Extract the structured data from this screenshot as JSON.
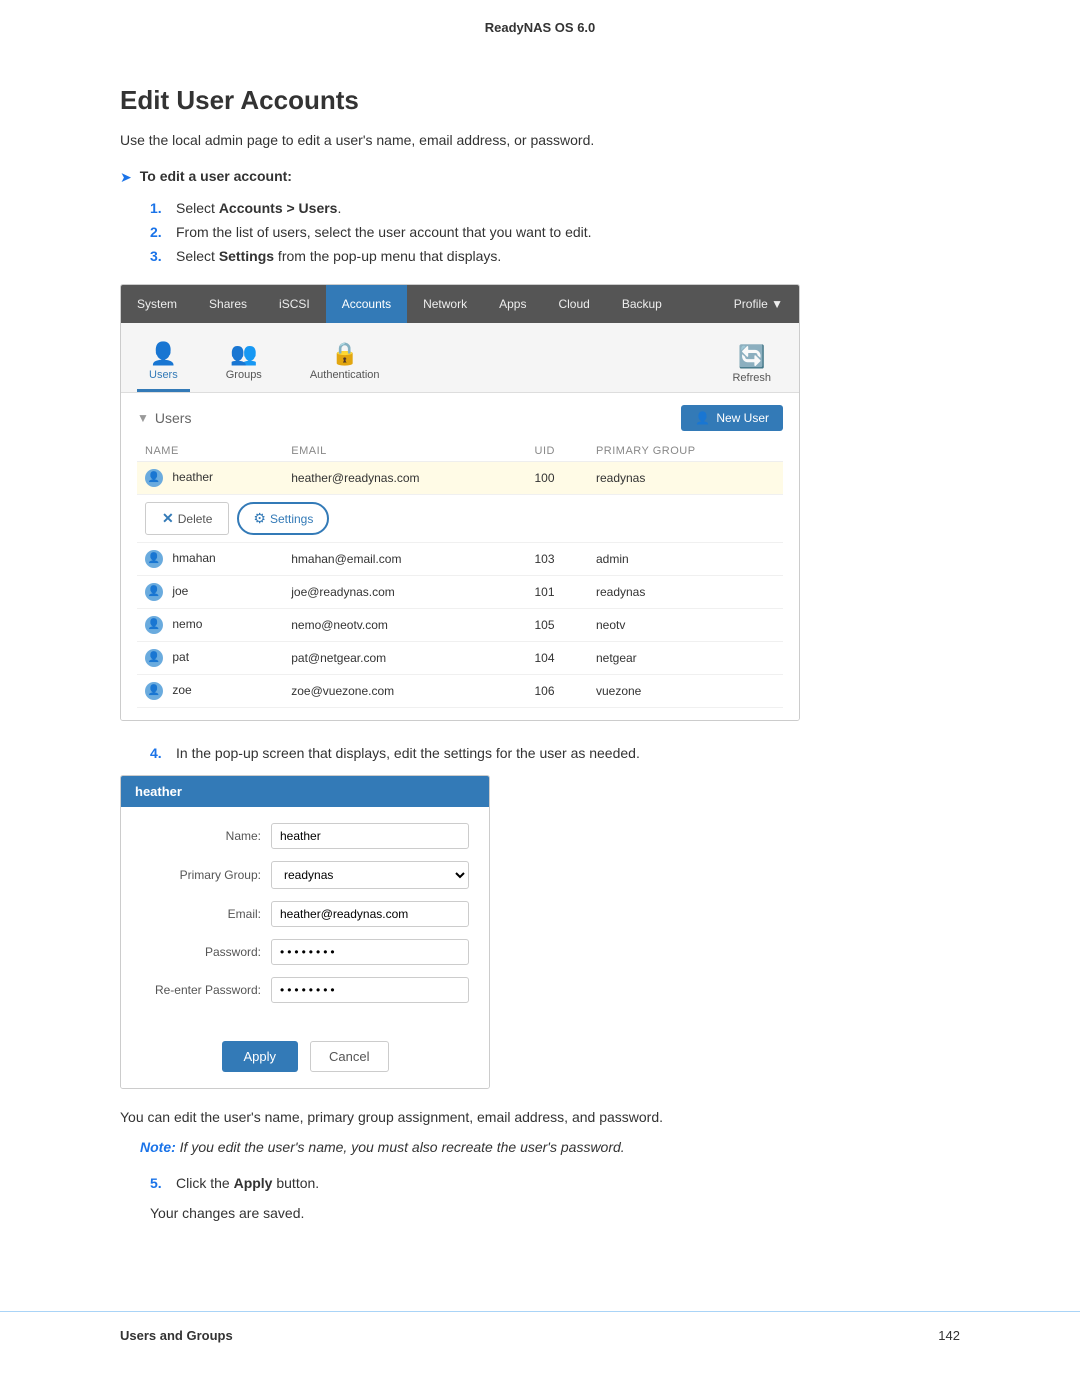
{
  "header": {
    "title": "ReadyNAS OS 6.0"
  },
  "page": {
    "title": "Edit User Accounts",
    "intro": "Use the local admin page to edit a user's name, email address, or password.",
    "task_heading": "To edit a user account:",
    "steps": [
      {
        "num": "1.",
        "text_before": "Select ",
        "bold": "Accounts > Users",
        "text_after": "."
      },
      {
        "num": "2.",
        "text_before": "From the list of users, select the user account that you want to edit.",
        "bold": "",
        "text_after": ""
      },
      {
        "num": "3.",
        "text_before": "Select ",
        "bold": "Settings",
        "text_after": " from the pop-up menu that displays."
      }
    ]
  },
  "nas_ui": {
    "navbar": {
      "items": [
        {
          "label": "System",
          "active": false
        },
        {
          "label": "Shares",
          "active": false
        },
        {
          "label": "iSCSI",
          "active": false
        },
        {
          "label": "Accounts",
          "active": true
        },
        {
          "label": "Network",
          "active": false
        },
        {
          "label": "Apps",
          "active": false
        },
        {
          "label": "Cloud",
          "active": false
        },
        {
          "label": "Backup",
          "active": false
        }
      ],
      "profile_label": "Profile ▼"
    },
    "subbar": {
      "items": [
        {
          "label": "Users",
          "icon": "👤",
          "active": true
        },
        {
          "label": "Groups",
          "icon": "👥",
          "active": false
        },
        {
          "label": "Authentication",
          "icon": "🔒",
          "active": false
        }
      ],
      "refresh_label": "Refresh"
    },
    "users_section": {
      "title": "Users",
      "new_user_label": "New User"
    },
    "table": {
      "columns": [
        "NAME",
        "EMAIL",
        "UID",
        "PRIMARY GROUP"
      ],
      "rows": [
        {
          "name": "heather",
          "email": "heather@readynas.com",
          "uid": "100",
          "group": "readynas",
          "highlighted": true,
          "show_popup": true
        },
        {
          "name": "hmahan",
          "email": "hmahan@email.com",
          "uid": "103",
          "group": "admin",
          "highlighted": false,
          "show_popup": false
        },
        {
          "name": "joe",
          "email": "joe@readynas.com",
          "uid": "101",
          "group": "readynas",
          "highlighted": false,
          "show_popup": false
        },
        {
          "name": "nemo",
          "email": "nemo@neotv.com",
          "uid": "105",
          "group": "neotv",
          "highlighted": false,
          "show_popup": false
        },
        {
          "name": "pat",
          "email": "pat@netgear.com",
          "uid": "104",
          "group": "netgear",
          "highlighted": false,
          "show_popup": false
        },
        {
          "name": "zoe",
          "email": "zoe@vuezone.com",
          "uid": "106",
          "group": "vuezone",
          "highlighted": false,
          "show_popup": false
        }
      ],
      "popup": {
        "delete_label": "Delete",
        "settings_label": "Settings"
      }
    }
  },
  "step4_text": "In the pop-up screen that displays, edit the settings for the user as needed.",
  "dialog": {
    "header": "heather",
    "fields": [
      {
        "label": "Name:",
        "type": "text",
        "value": "heather"
      },
      {
        "label": "Primary Group:",
        "type": "select",
        "value": "readynas"
      },
      {
        "label": "Email:",
        "type": "text",
        "value": "heather@readynas.com"
      },
      {
        "label": "Password:",
        "type": "password",
        "value": "········"
      },
      {
        "label": "Re-enter Password:",
        "type": "password",
        "value": "········"
      }
    ],
    "apply_label": "Apply",
    "cancel_label": "Cancel"
  },
  "after_dialog_text": "You can edit the user's name, primary group assignment, email address, and password.",
  "note": {
    "label": "Note:",
    "text": " If you edit the user's name, you must also recreate the user's password."
  },
  "step5": {
    "num": "5.",
    "text_before": "Click the ",
    "bold": "Apply",
    "text_after": " button."
  },
  "step5_sub": "Your changes are saved.",
  "footer": {
    "section_label": "Users and Groups",
    "page_number": "142"
  }
}
